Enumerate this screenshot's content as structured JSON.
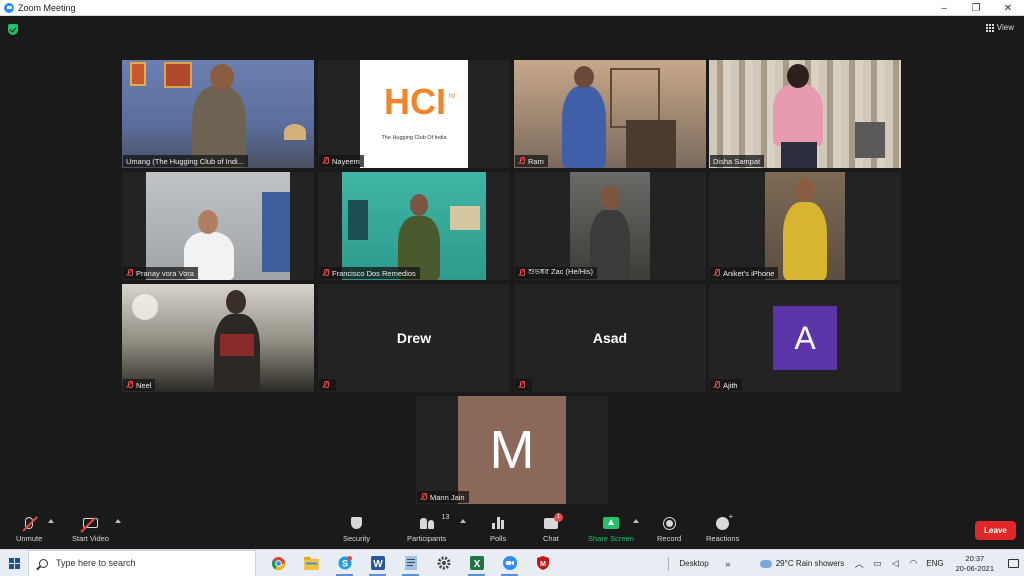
{
  "window": {
    "title": "Zoom Meeting",
    "minimize": "–",
    "maximize": "❐",
    "close": "✕"
  },
  "meeting": {
    "view_label": "View",
    "participants": [
      {
        "name": "Umang (The Hugging Club of Indi...",
        "muted": false,
        "type": "video"
      },
      {
        "name": "Nayeem",
        "muted": true,
        "type": "logo",
        "logo_text": "HCI",
        "logo_caption": "The Hugging Club Of India",
        "logo_tm": "TM"
      },
      {
        "name": "Ram",
        "muted": true,
        "type": "video"
      },
      {
        "name": "Disha Sampat",
        "muted": false,
        "type": "video",
        "active_speaker": true
      },
      {
        "name": "Pranay vora Vora",
        "muted": true,
        "type": "video"
      },
      {
        "name": "Francisco Dos Remedios",
        "muted": true,
        "type": "video"
      },
      {
        "name": "শুভঙ্কর Zac (He/His)",
        "muted": true,
        "type": "video"
      },
      {
        "name": "Aniket's iPhone",
        "muted": true,
        "type": "video"
      },
      {
        "name": "Neel",
        "muted": true,
        "type": "video"
      },
      {
        "name": "",
        "display_name": "Drew",
        "muted": true,
        "type": "name"
      },
      {
        "name": "",
        "display_name": "Asad",
        "muted": true,
        "type": "name"
      },
      {
        "name": "Ajith",
        "muted": true,
        "type": "avatar",
        "avatar_letter": "A",
        "avatar_color": "#5b35a8"
      },
      {
        "name": "Mann Jain",
        "muted": true,
        "type": "avatar",
        "avatar_letter": "M",
        "avatar_color": "#8b6a5c"
      }
    ]
  },
  "toolbar": {
    "unmute": "Unmute",
    "start_video": "Start Video",
    "security": "Security",
    "participants": "Participants",
    "participants_count": "13",
    "polls": "Polls",
    "chat": "Chat",
    "chat_badge": "1",
    "share_screen": "Share Screen",
    "record": "Record",
    "reactions": "Reactions",
    "leave": "Leave",
    "colors": {
      "share": "#23c16b",
      "leave": "#e02828",
      "muted": "#e24a4a",
      "active_speaker": "#c8d85a"
    }
  },
  "taskbar": {
    "search_placeholder": "Type here to search",
    "apps": [
      "chrome-icon",
      "file-explorer-icon",
      "skype-icon",
      "word-icon",
      "notepad-icon",
      "settings-icon",
      "excel-icon",
      "zoom-icon",
      "mcafee-icon"
    ],
    "desktop_label": "Desktop",
    "weather": "29°C  Rain showers",
    "language": "ENG",
    "time": "20:37",
    "date": "20-06-2021"
  }
}
